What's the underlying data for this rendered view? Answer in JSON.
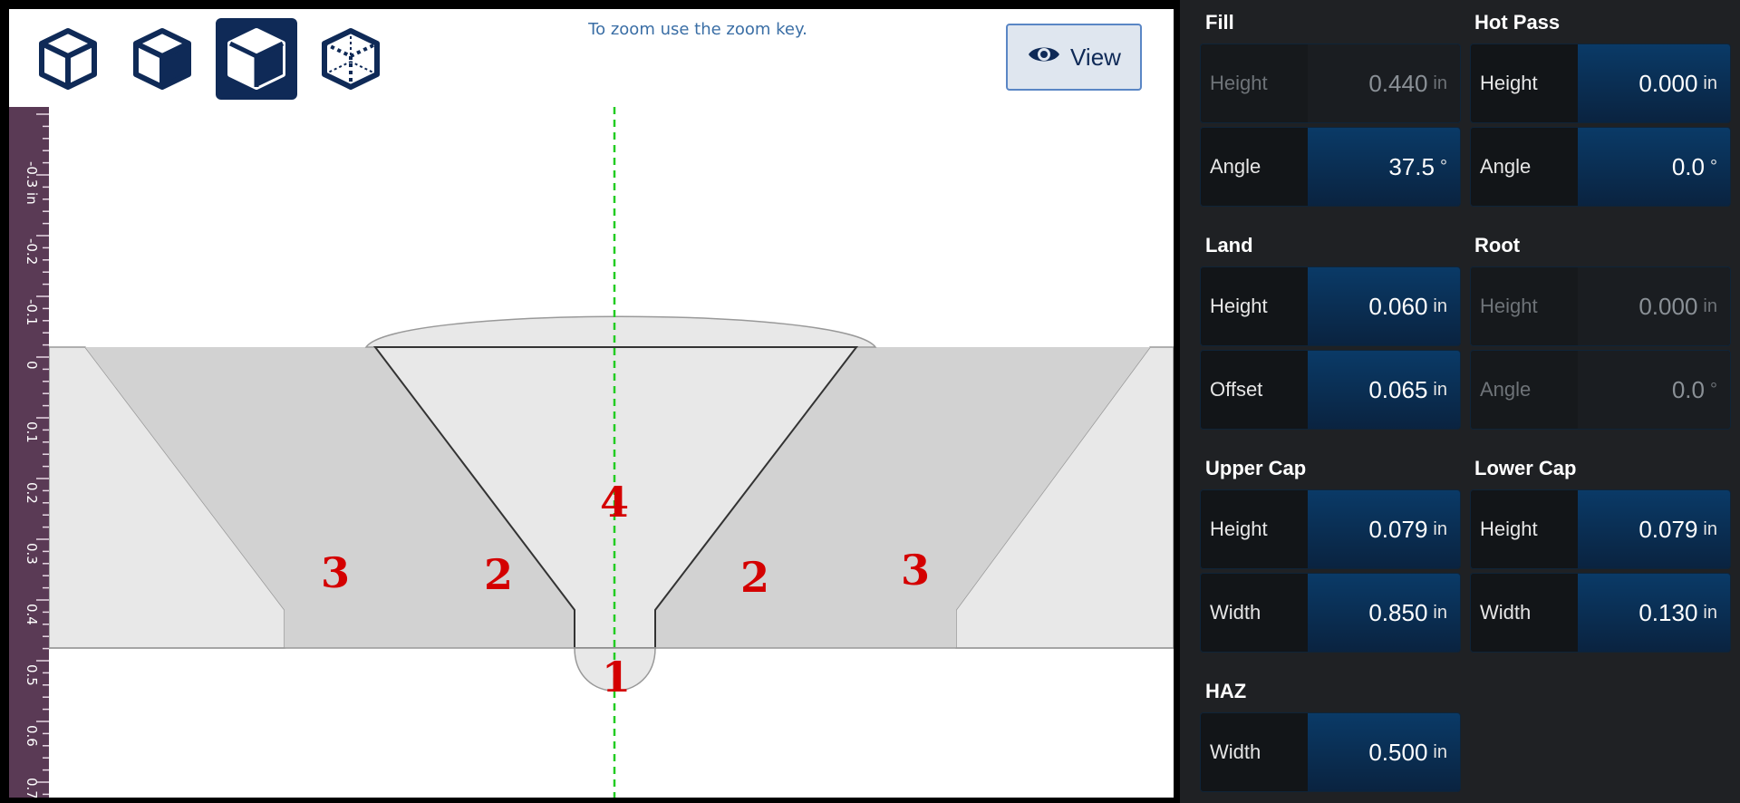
{
  "viewer": {
    "hint": "To zoom use the zoom key.",
    "view_button_label": "View",
    "view_icons": [
      "cube-solid-icon",
      "cube-shaded-icon",
      "cube-active-icon",
      "cube-wireframe-icon"
    ],
    "ruler_unit": "in",
    "ruler_labels": [
      "-0.3 in",
      "-0.2",
      "-0.1",
      "0",
      "0.1",
      "0.2",
      "0.3",
      "0.4",
      "0.5",
      "0.6",
      "0.7"
    ],
    "region_labels": [
      "3",
      "2",
      "4",
      "2",
      "3",
      "1"
    ]
  },
  "panel": {
    "fill": {
      "title": "Fill",
      "height_label": "Height",
      "height_value": "0.440",
      "height_unit": "in",
      "angle_label": "Angle",
      "angle_value": "37.5",
      "angle_unit": "°"
    },
    "hot_pass": {
      "title": "Hot Pass",
      "height_label": "Height",
      "height_value": "0.000",
      "height_unit": "in",
      "angle_label": "Angle",
      "angle_value": "0.0",
      "angle_unit": "°"
    },
    "land": {
      "title": "Land",
      "height_label": "Height",
      "height_value": "0.060",
      "height_unit": "in",
      "offset_label": "Offset",
      "offset_value": "0.065",
      "offset_unit": "in"
    },
    "root": {
      "title": "Root",
      "height_label": "Height",
      "height_value": "0.000",
      "height_unit": "in",
      "angle_label": "Angle",
      "angle_value": "0.0",
      "angle_unit": "°"
    },
    "upper_cap": {
      "title": "Upper Cap",
      "height_label": "Height",
      "height_value": "0.079",
      "height_unit": "in",
      "width_label": "Width",
      "width_value": "0.850",
      "width_unit": "in"
    },
    "lower_cap": {
      "title": "Lower Cap",
      "height_label": "Height",
      "height_value": "0.079",
      "height_unit": "in",
      "width_label": "Width",
      "width_value": "0.130",
      "width_unit": "in"
    },
    "haz": {
      "title": "HAZ",
      "width_label": "Width",
      "width_value": "0.500",
      "width_unit": "in"
    }
  },
  "colors": {
    "active_icon_bg": "#0f2a57",
    "field_value_bg": "#0a3a67",
    "region_label": "#d40000",
    "center_line": "#22cc22"
  }
}
